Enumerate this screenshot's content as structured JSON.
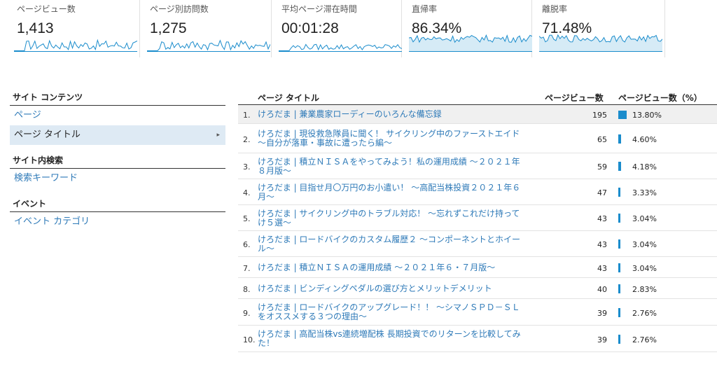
{
  "metrics": [
    {
      "label": "ページビュー数",
      "value": "1,413"
    },
    {
      "label": "ページ別訪問数",
      "value": "1,275"
    },
    {
      "label": "平均ページ滞在時間",
      "value": "00:01:28"
    },
    {
      "label": "直帰率",
      "value": "86.34%"
    },
    {
      "label": "離脱率",
      "value": "71.48%"
    }
  ],
  "nav": {
    "site_content_head": "サイト コンテンツ",
    "page": "ページ",
    "page_title": "ページ タイトル",
    "site_search_head": "サイト内検索",
    "search_keyword": "検索キーワード",
    "event_head": "イベント",
    "event_category": "イベント カテゴリ"
  },
  "table": {
    "col_title": "ページ タイトル",
    "col_pv": "ページビュー数",
    "col_pct": "ページビュー数（%）",
    "rows": [
      {
        "num": "1.",
        "title": "けろだま | 兼業農家ローディーのいろんな備忘録",
        "pv": "195",
        "pct": "13.80%",
        "share": 13.8
      },
      {
        "num": "2.",
        "title": "けろだま | 現役救急隊員に聞く！ サイクリング中のファーストエイド ～自分が落車・事故に遭ったら編～",
        "pv": "65",
        "pct": "4.60%",
        "share": 4.6
      },
      {
        "num": "3.",
        "title": "けろだま | 積立ＮＩＳＡをやってみよう！私の運用成績 ～２０２１年８月版～",
        "pv": "59",
        "pct": "4.18%",
        "share": 4.18
      },
      {
        "num": "4.",
        "title": "けろだま | 目指せ月〇万円のお小遣い！ ～高配当株投資２０２１年６月～",
        "pv": "47",
        "pct": "3.33%",
        "share": 3.33
      },
      {
        "num": "5.",
        "title": "けろだま | サイクリング中のトラブル対応！ ～忘れずこれだけ持ってけ５選～",
        "pv": "43",
        "pct": "3.04%",
        "share": 3.04
      },
      {
        "num": "6.",
        "title": "けろだま | ロードバイクのカスタム履歴２ ～コンポーネントとホイール～",
        "pv": "43",
        "pct": "3.04%",
        "share": 3.04
      },
      {
        "num": "7.",
        "title": "けろだま | 積立ＮＩＳＡの運用成績 ～２０２１年６・７月版～",
        "pv": "43",
        "pct": "3.04%",
        "share": 3.04
      },
      {
        "num": "8.",
        "title": "けろだま | ビンディングペダルの選び方とメリットデメリット",
        "pv": "40",
        "pct": "2.83%",
        "share": 2.83
      },
      {
        "num": "9.",
        "title": "けろだま | ロードバイクのアップグレード！！ ～シマノＳＰＤ－ＳＬをオススメする３つの理由～",
        "pv": "39",
        "pct": "2.76%",
        "share": 2.76
      },
      {
        "num": "10.",
        "title": "けろだま | 高配当株vs連続増配株 長期投資でのリターンを比較してみた！",
        "pv": "39",
        "pct": "2.76%",
        "share": 2.76
      }
    ]
  },
  "colors": {
    "accent": "#1a8ccc",
    "link": "#2e7ab8",
    "spark_fill": "#d6ebf6"
  }
}
